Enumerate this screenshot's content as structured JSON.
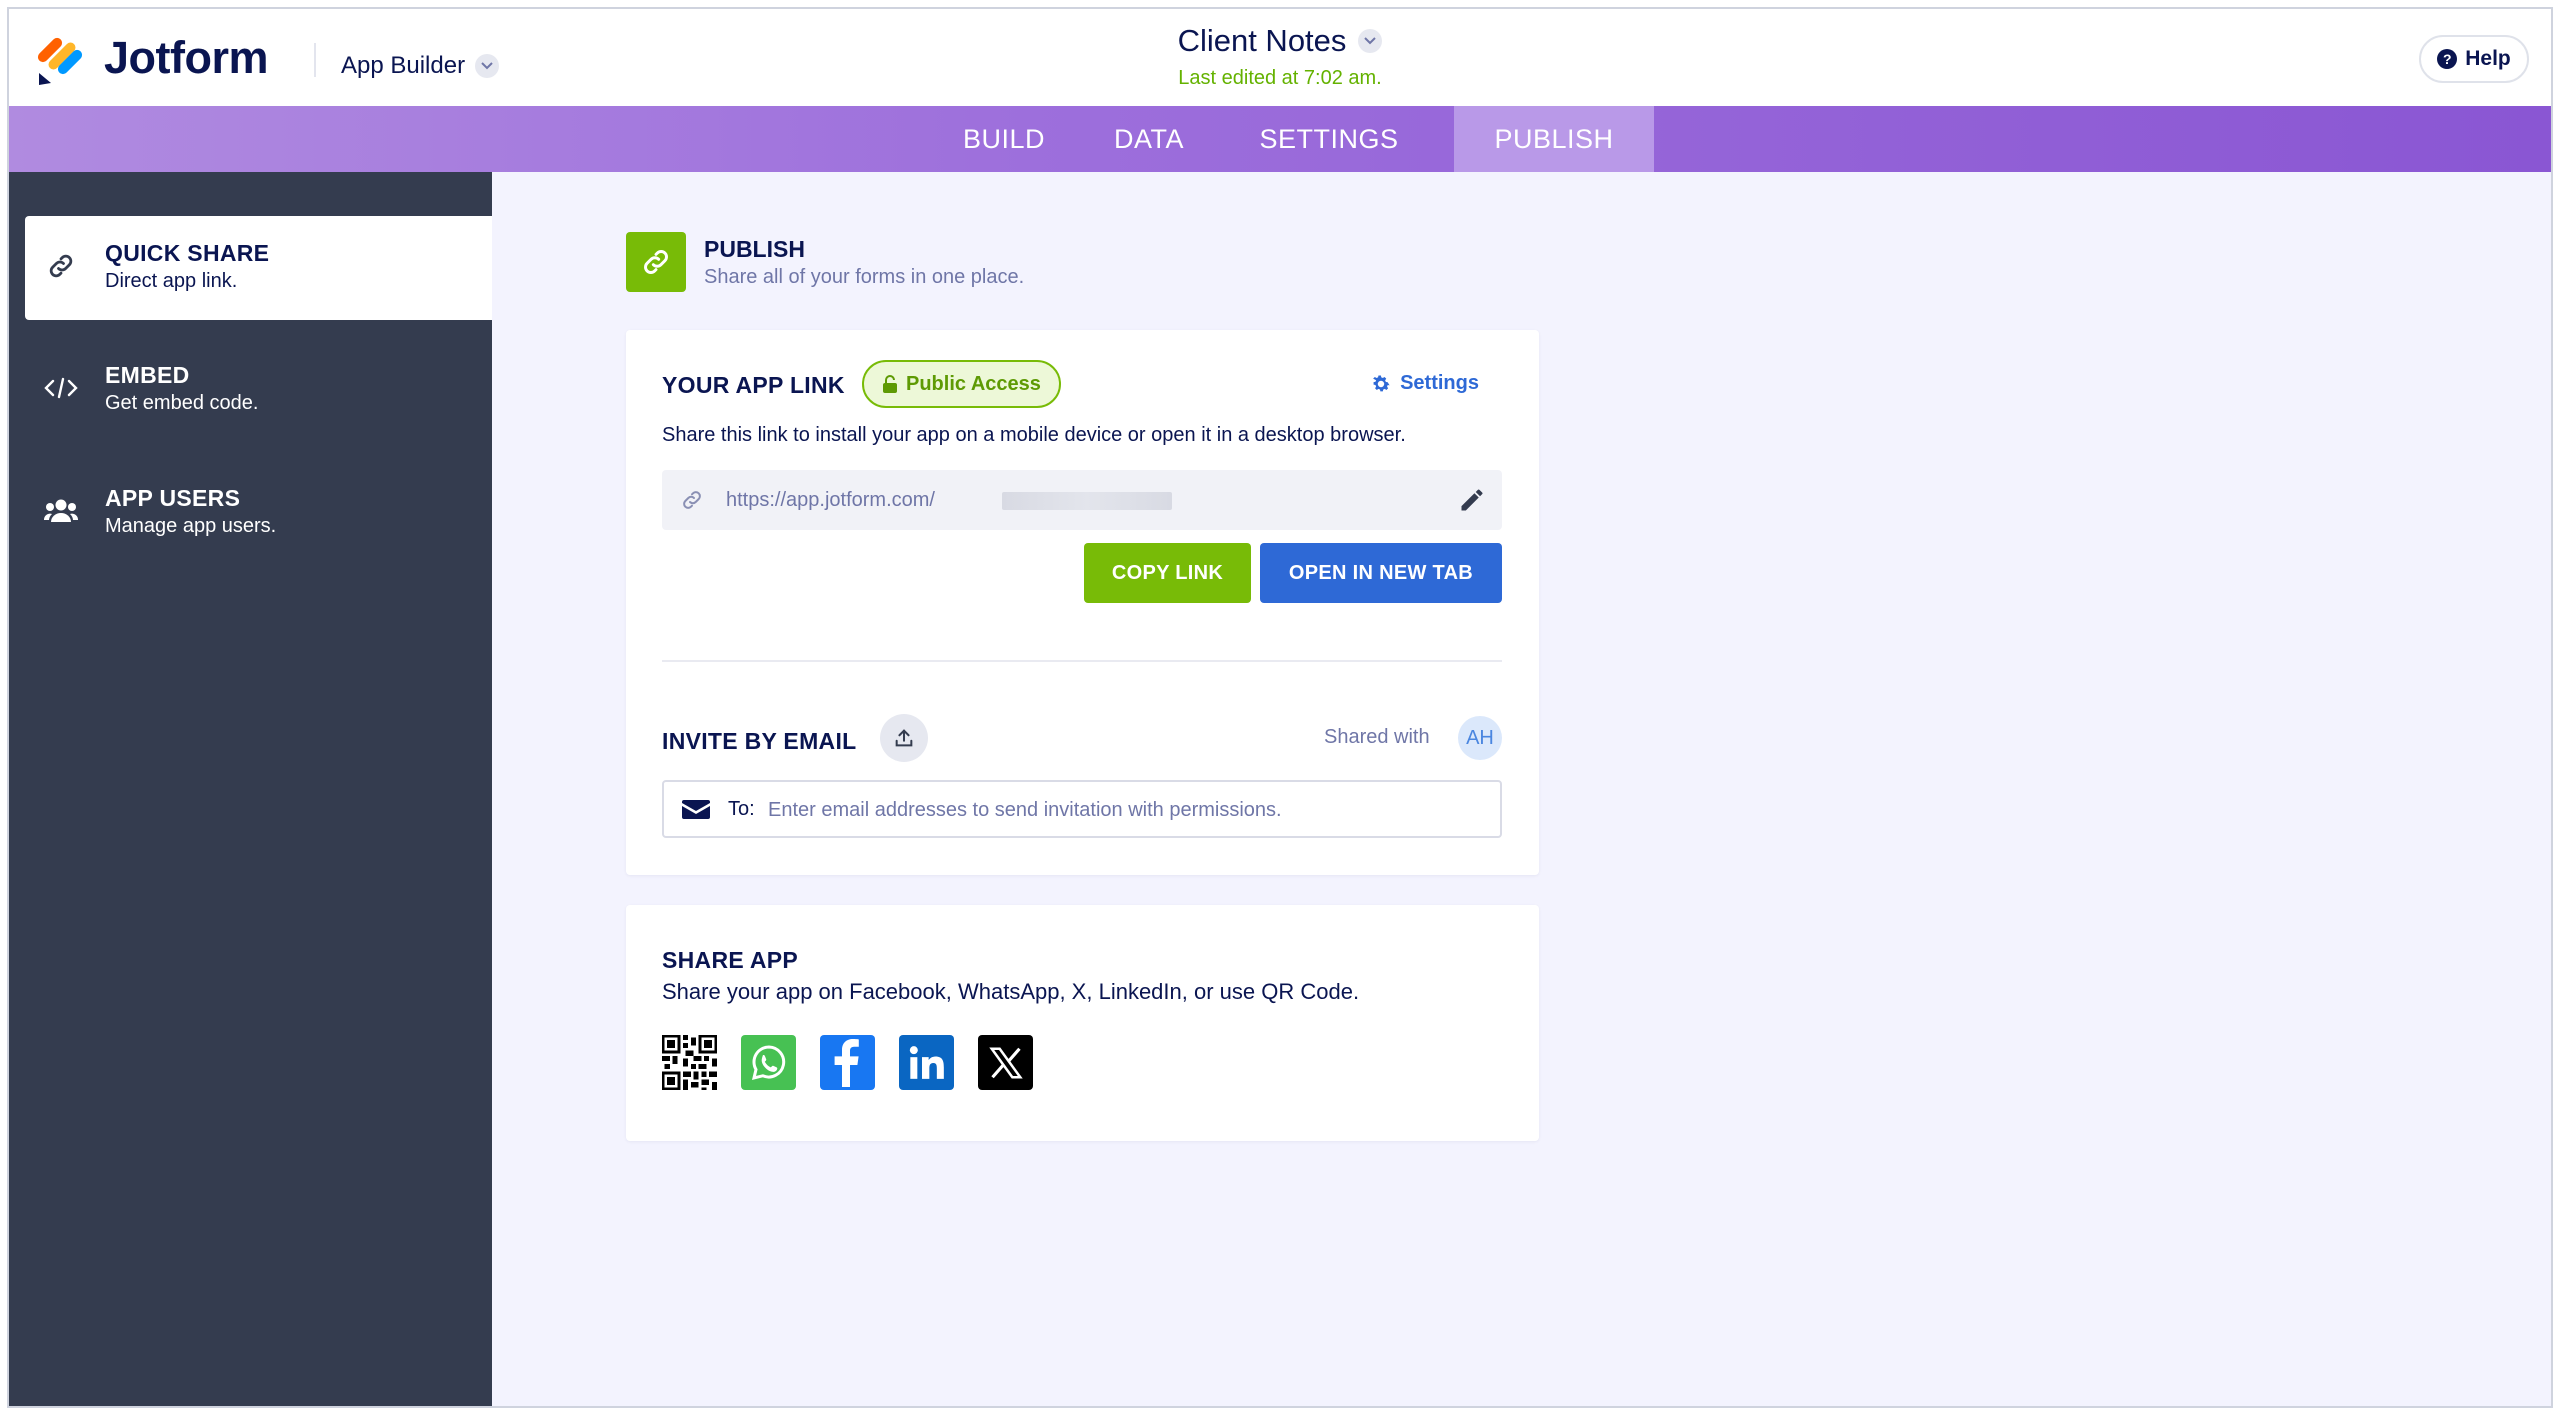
{
  "header": {
    "brand": "Jotform",
    "app_builder_label": "App Builder",
    "app_title": "Client Notes",
    "last_edited": "Last edited at 7:02 am.",
    "help_label": "Help"
  },
  "tabs": [
    {
      "label": "BUILD",
      "active": false
    },
    {
      "label": "DATA",
      "active": false
    },
    {
      "label": "SETTINGS",
      "active": false
    },
    {
      "label": "PUBLISH",
      "active": true
    }
  ],
  "sidebar": {
    "items": [
      {
        "title": "QUICK SHARE",
        "subtitle": "Direct app link.",
        "icon": "link-icon",
        "active": true
      },
      {
        "title": "EMBED",
        "subtitle": "Get embed code.",
        "icon": "code-icon",
        "active": false
      },
      {
        "title": "APP USERS",
        "subtitle": "Manage app users.",
        "icon": "users-icon",
        "active": false
      }
    ]
  },
  "publish": {
    "title": "PUBLISH",
    "subtitle": "Share all of your forms in one place."
  },
  "app_link": {
    "heading": "YOUR APP LINK",
    "badge": "Public Access",
    "settings_label": "Settings",
    "description": "Share this link to install your app on a mobile device or open it in a desktop browser.",
    "url": "https://app.jotform.com/",
    "copy_button": "COPY LINK",
    "open_button": "OPEN IN NEW TAB"
  },
  "invite": {
    "heading": "INVITE BY EMAIL",
    "shared_with_label": "Shared with",
    "avatar_initials": "AH",
    "to_label": "To:",
    "placeholder": "Enter email addresses to send invitation with permissions."
  },
  "share_app": {
    "heading": "SHARE APP",
    "description": "Share your app on Facebook, WhatsApp, X, LinkedIn, or use QR Code.",
    "icons": [
      "qr-code-icon",
      "whatsapp-icon",
      "facebook-icon",
      "linkedin-icon",
      "x-icon"
    ]
  },
  "colors": {
    "brand_navy": "#0a1551",
    "accent_green": "#78bb07",
    "accent_blue": "#2e69d6",
    "tab_purple": "#9d6fdc",
    "sidebar_bg": "#343c4f",
    "main_bg": "#f3f3fe"
  }
}
